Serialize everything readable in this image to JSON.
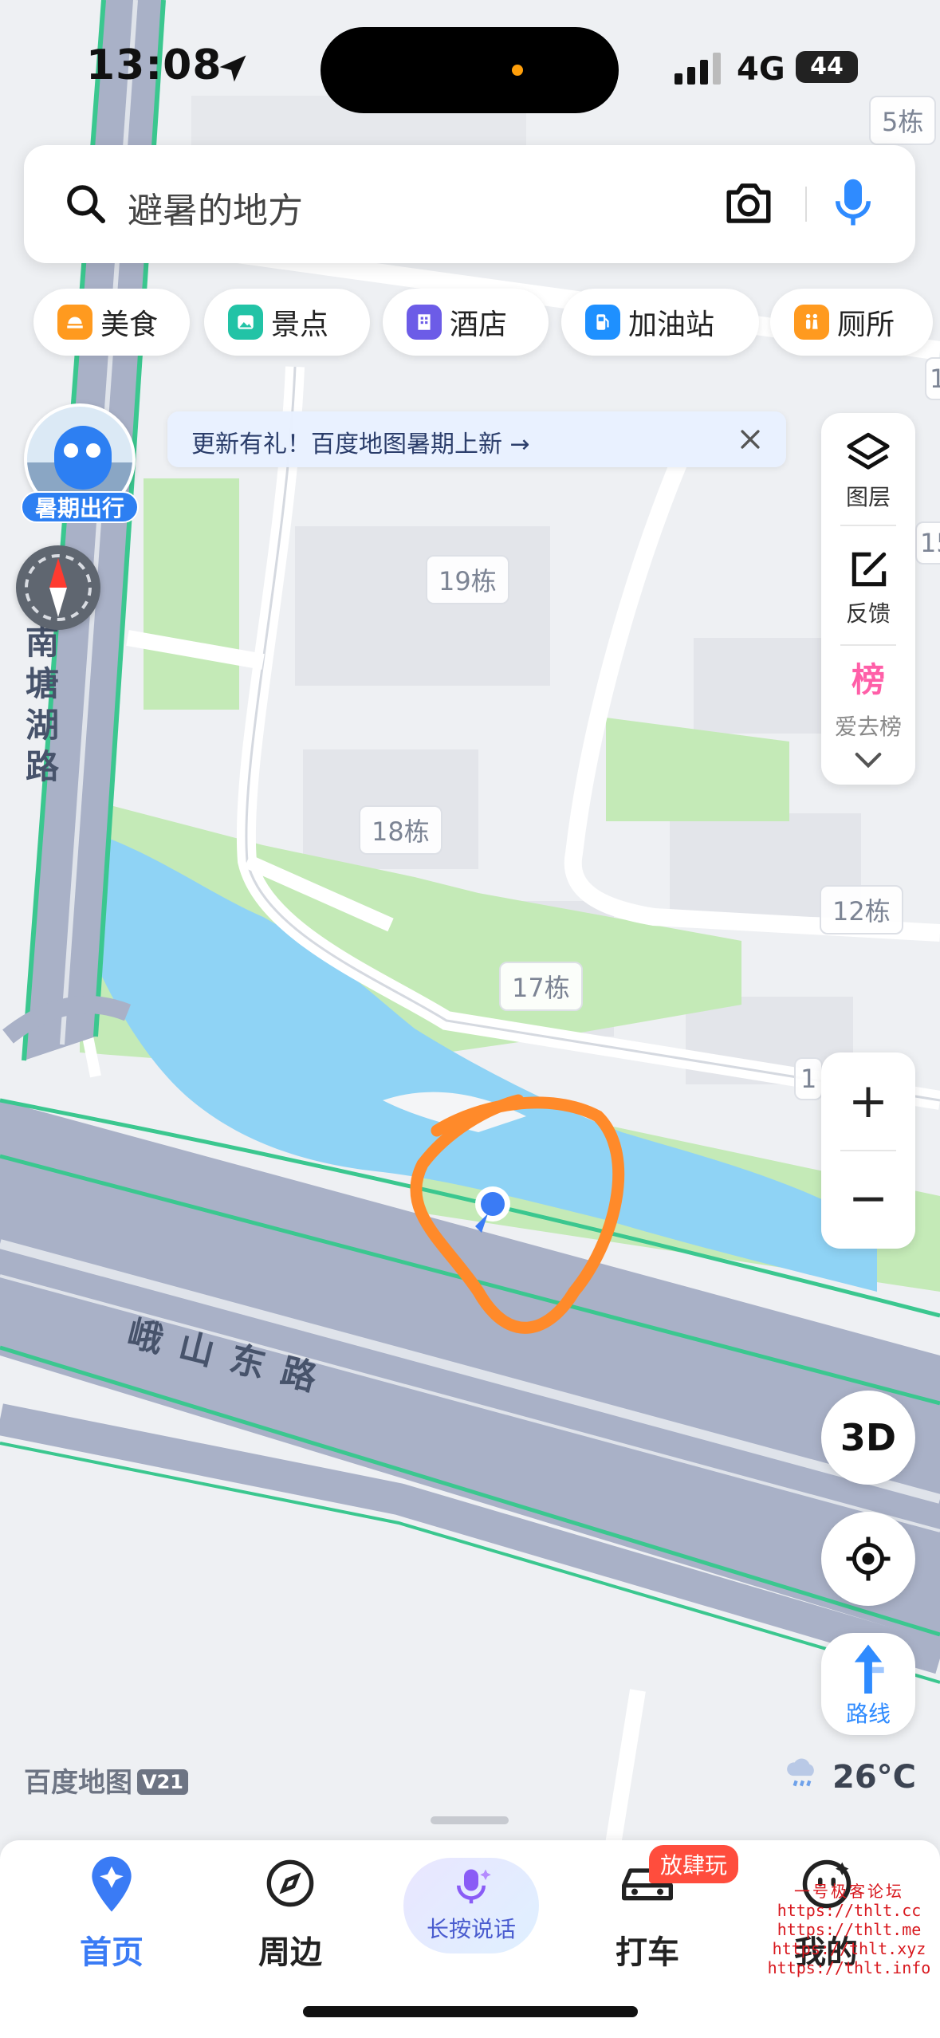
{
  "status_bar": {
    "time": "13:08",
    "network": "4G",
    "battery": "44"
  },
  "search": {
    "placeholder": "避暑的地方"
  },
  "categories": [
    {
      "label": "美食",
      "icon": "food-icon",
      "color": "#ff9a1f"
    },
    {
      "label": "景点",
      "icon": "scenic-icon",
      "color": "#22c3a6"
    },
    {
      "label": "酒店",
      "icon": "hotel-icon",
      "color": "#6c5ce7"
    },
    {
      "label": "加油站",
      "icon": "gas-station-icon",
      "color": "#1e90ff"
    },
    {
      "label": "厕所",
      "icon": "toilet-icon",
      "color": "#ff9a1f"
    }
  ],
  "banner": {
    "text": "更新有礼！百度地图暑期上新 →"
  },
  "promo": {
    "label": "暑期出行"
  },
  "map": {
    "road_vertical": "南塘湖路",
    "road_main": "峨山东路",
    "buildings": [
      "5栋",
      "19栋",
      "18栋",
      "17栋",
      "12栋",
      "1",
      "15",
      "1"
    ]
  },
  "right_panel": {
    "layers": "图层",
    "feedback": "反馈",
    "ranking_badge": "榜",
    "ranking": "爱去榜"
  },
  "controls": {
    "zoom_in": "+",
    "zoom_out": "−",
    "three_d": "3D",
    "route": "路线"
  },
  "logo": {
    "name": "百度地图",
    "version": "V21"
  },
  "weather": {
    "temp": "26°C"
  },
  "bottom_nav": {
    "home": "首页",
    "nearby": "周边",
    "voice": "长按说话",
    "taxi": "打车",
    "taxi_badge": "放肆玩",
    "mine": "我的"
  },
  "watermark": [
    "一号极客论坛",
    "https://thlt.cc",
    "https://thlt.me",
    "https://thlt.xyz",
    "https://thlt.info"
  ],
  "colors": {
    "accent": "#3a7bf5",
    "water": "#8fd3f5",
    "green": "#c4eab7",
    "road": "#a9b1c7",
    "annotation": "#ff8a2a"
  }
}
